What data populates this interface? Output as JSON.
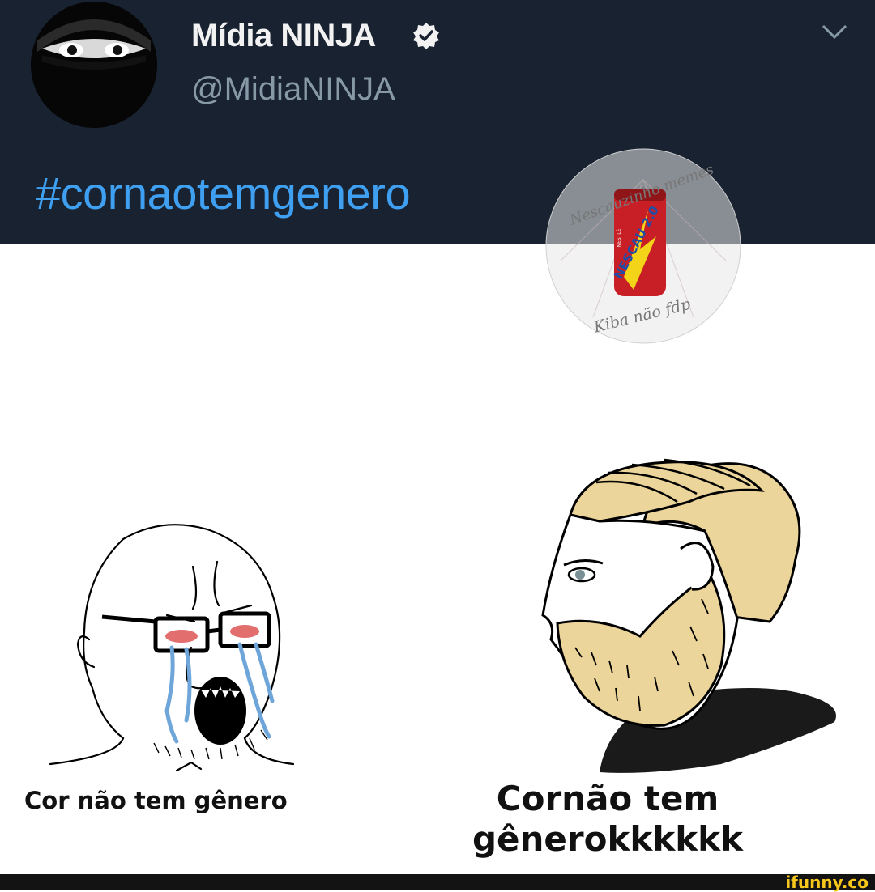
{
  "tweet": {
    "display_name": "Mídia NINJA",
    "handle": "@MidiaNINJA",
    "hashtag": "#cornaotemgenero",
    "icons": {
      "verified": "verified-badge-icon",
      "menu": "chevron-down-icon"
    }
  },
  "watermark": {
    "top_text": "Nescauzinho memes",
    "can_label": "NESCAU 2.0",
    "can_small_label": "NESTLÉ",
    "bottom_text": "Kiba não fdp"
  },
  "meme": {
    "left_caption": "Cor não tem gênero",
    "right_caption_line1": "Cornão tem",
    "right_caption_line2": "gênerokkkkkk"
  },
  "footer": {
    "brand": "ifunny.co"
  },
  "colors": {
    "tweet_bg": "#182231",
    "hashtag": "#3f9ff0",
    "handle": "#8899a6",
    "brand": "#f7c71b",
    "chad_hair": "#ecd59a"
  }
}
